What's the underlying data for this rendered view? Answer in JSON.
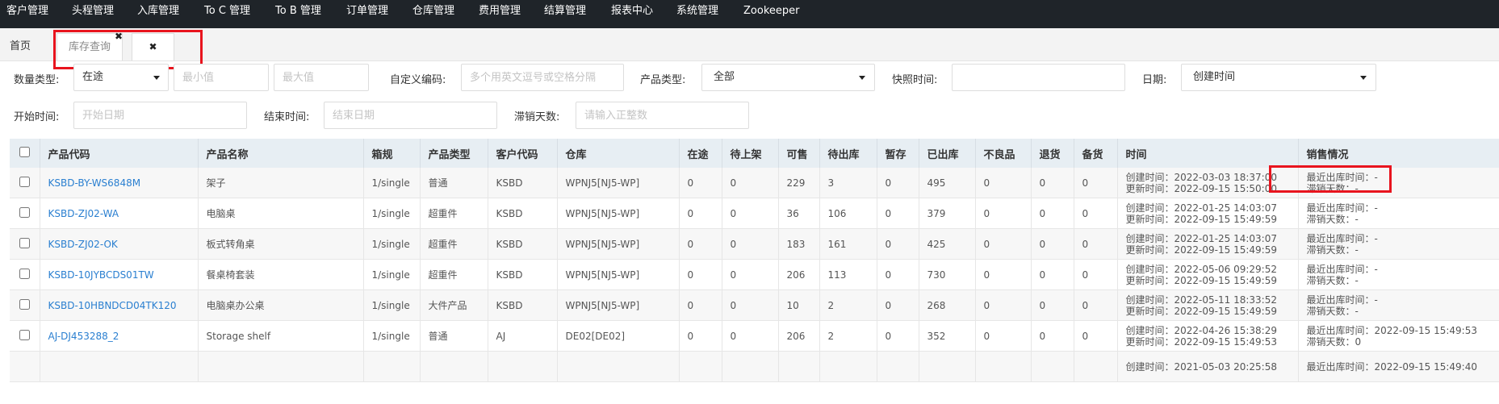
{
  "nav": [
    "客户管理",
    "头程管理",
    "入库管理",
    "To C 管理",
    "To B 管理",
    "订单管理",
    "仓库管理",
    "费用管理",
    "结算管理",
    "报表中心",
    "系统管理",
    "Zookeeper"
  ],
  "tabs": {
    "home": "首页",
    "active": "库存查询",
    "close_glyph": "✖"
  },
  "filters": {
    "qty_type_label": "数量类型:",
    "qty_type_value": "在途",
    "min_placeholder": "最小值",
    "max_placeholder": "最大值",
    "custom_code_label": "自定义编码:",
    "custom_code_placeholder": "多个用英文逗号或空格分隔",
    "product_type_label": "产品类型:",
    "product_type_value": "全部",
    "snapshot_label": "快照时间:",
    "date_label": "日期:",
    "date_value": "创建时间",
    "start_label": "开始时间:",
    "start_placeholder": "开始日期",
    "end_label": "结束时间:",
    "end_placeholder": "结束日期",
    "stale_label": "滞销天数:",
    "stale_placeholder": "请输入正整数"
  },
  "table": {
    "headers": [
      "产品代码",
      "产品名称",
      "箱规",
      "产品类型",
      "客户代码",
      "仓库",
      "在途",
      "待上架",
      "可售",
      "待出库",
      "暂存",
      "已出库",
      "不良品",
      "退货",
      "备货",
      "时间",
      "销售情况"
    ],
    "created_prefix": "创建时间：",
    "updated_prefix": "更新时间：",
    "last_out_prefix": "最近出库时间：",
    "stale_prefix": "滞销天数：",
    "rows": [
      {
        "code": "KSBD-BY-WS6848M",
        "name": "架子",
        "spec": "1/single",
        "type": "普通",
        "customer": "KSBD",
        "warehouse": "WPNJ5[NJ5-WP]",
        "transit": "0",
        "pending_shelf": "0",
        "sellable": "229",
        "pending_out": "3",
        "temp": "0",
        "shipped": "495",
        "defective": "0",
        "returned": "0",
        "stock": "0",
        "created": "2022-03-03 18:37:00",
        "updated": "2022-09-15 15:50:00",
        "last_out": "-",
        "stale_days": "-"
      },
      {
        "code": "KSBD-ZJ02-WA",
        "name": "电脑桌",
        "spec": "1/single",
        "type": "超重件",
        "customer": "KSBD",
        "warehouse": "WPNJ5[NJ5-WP]",
        "transit": "0",
        "pending_shelf": "0",
        "sellable": "36",
        "pending_out": "106",
        "temp": "0",
        "shipped": "379",
        "defective": "0",
        "returned": "0",
        "stock": "0",
        "created": "2022-01-25 14:03:07",
        "updated": "2022-09-15 15:49:59",
        "last_out": "-",
        "stale_days": "-"
      },
      {
        "code": "KSBD-ZJ02-OK",
        "name": "板式转角桌",
        "spec": "1/single",
        "type": "超重件",
        "customer": "KSBD",
        "warehouse": "WPNJ5[NJ5-WP]",
        "transit": "0",
        "pending_shelf": "0",
        "sellable": "183",
        "pending_out": "161",
        "temp": "0",
        "shipped": "425",
        "defective": "0",
        "returned": "0",
        "stock": "0",
        "created": "2022-01-25 14:03:07",
        "updated": "2022-09-15 15:49:59",
        "last_out": "-",
        "stale_days": "-"
      },
      {
        "code": "KSBD-10JYBCDS01TW",
        "name": "餐桌椅套装",
        "spec": "1/single",
        "type": "超重件",
        "customer": "KSBD",
        "warehouse": "WPNJ5[NJ5-WP]",
        "transit": "0",
        "pending_shelf": "0",
        "sellable": "206",
        "pending_out": "113",
        "temp": "0",
        "shipped": "730",
        "defective": "0",
        "returned": "0",
        "stock": "0",
        "created": "2022-05-06 09:29:52",
        "updated": "2022-09-15 15:49:59",
        "last_out": "-",
        "stale_days": "-"
      },
      {
        "code": "KSBD-10HBNDCD04TK120",
        "name": "电脑桌办公桌",
        "spec": "1/single",
        "type": "大件产品",
        "customer": "KSBD",
        "warehouse": "WPNJ5[NJ5-WP]",
        "transit": "0",
        "pending_shelf": "0",
        "sellable": "10",
        "pending_out": "2",
        "temp": "0",
        "shipped": "268",
        "defective": "0",
        "returned": "0",
        "stock": "0",
        "created": "2022-05-11 18:33:52",
        "updated": "2022-09-15 15:49:59",
        "last_out": "-",
        "stale_days": "-"
      },
      {
        "code": "AJ-DJ453288_2",
        "name": "Storage shelf",
        "spec": "1/single",
        "type": "普通",
        "customer": "AJ",
        "warehouse": "DE02[DE02]",
        "transit": "0",
        "pending_shelf": "0",
        "sellable": "206",
        "pending_out": "2",
        "temp": "0",
        "shipped": "352",
        "defective": "0",
        "returned": "0",
        "stock": "0",
        "created": "2022-04-26 15:38:29",
        "updated": "2022-09-15 15:49:53",
        "last_out": "2022-09-15 15:49:53",
        "stale_days": "0"
      },
      {
        "code": "",
        "name": "",
        "spec": "",
        "type": "",
        "customer": "",
        "warehouse": "",
        "transit": "",
        "pending_shelf": "",
        "sellable": "",
        "pending_out": "",
        "temp": "",
        "shipped": "",
        "defective": "",
        "returned": "",
        "stock": "",
        "created": "2021-05-03 20:25:58",
        "updated": "",
        "last_out": "2022-09-15 15:49:40",
        "stale_days": ""
      }
    ]
  }
}
